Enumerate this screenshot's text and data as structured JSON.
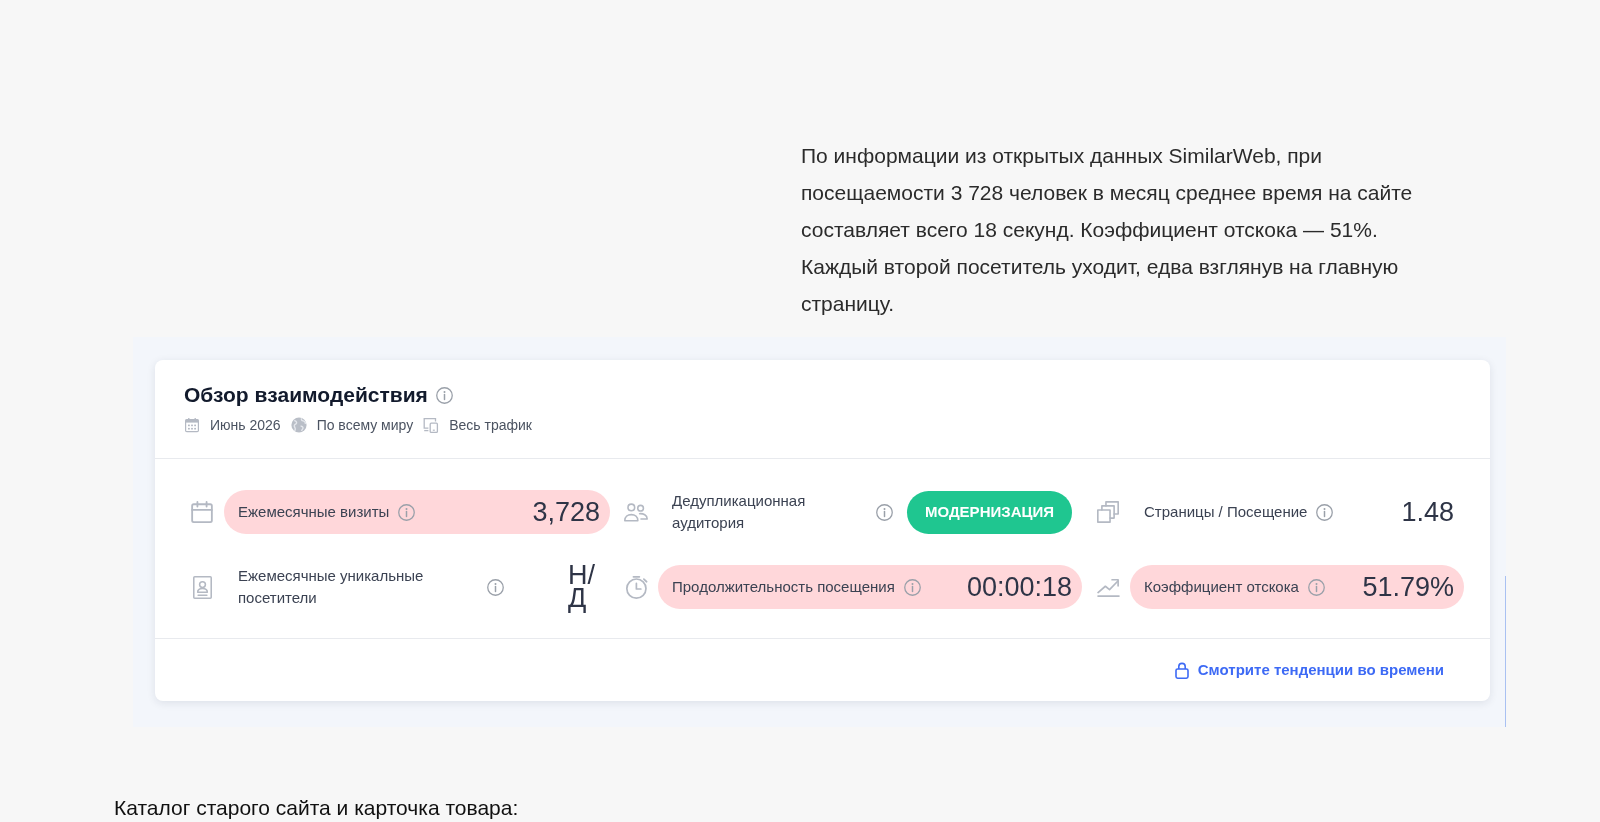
{
  "article": {
    "paragraph": "По информации из открытых данных SimilarWeb, при посещаемости 3 728 человек в месяц среднее время на сайте составляет всего 18 секунд. Коэффициент отскока — 51%. Каждый второй посетитель уходит, едва взглянув на главную страницу."
  },
  "engagement_card": {
    "title": "Обзор взаимодействия",
    "filters": [
      "Июнь 2026",
      "По всему миру",
      "Весь трафик"
    ],
    "metrics": [
      {
        "kind": "value",
        "label": "Ежемесячные визиты",
        "value": "3,728",
        "highlighted": true
      },
      {
        "kind": "button",
        "label": "Дедупликационная аудитория",
        "button": "МОДЕРНИЗАЦИЯ",
        "highlighted": false
      },
      {
        "kind": "value",
        "label": "Страницы / Посещение",
        "value": "1.48",
        "highlighted": false
      },
      {
        "kind": "value",
        "label": "Ежемесячные уникальные посетители",
        "value": "Н/Д",
        "highlighted": false
      },
      {
        "kind": "value",
        "label": "Продолжительность посещения",
        "value": "00:00:18",
        "highlighted": true
      },
      {
        "kind": "value",
        "label": "Коэффициент отскока",
        "value": "51.79%",
        "highlighted": true
      }
    ],
    "footer_link": "Смотрите тенденции во времени"
  },
  "caption": "Каталог старого сайта и карточка товара:"
}
